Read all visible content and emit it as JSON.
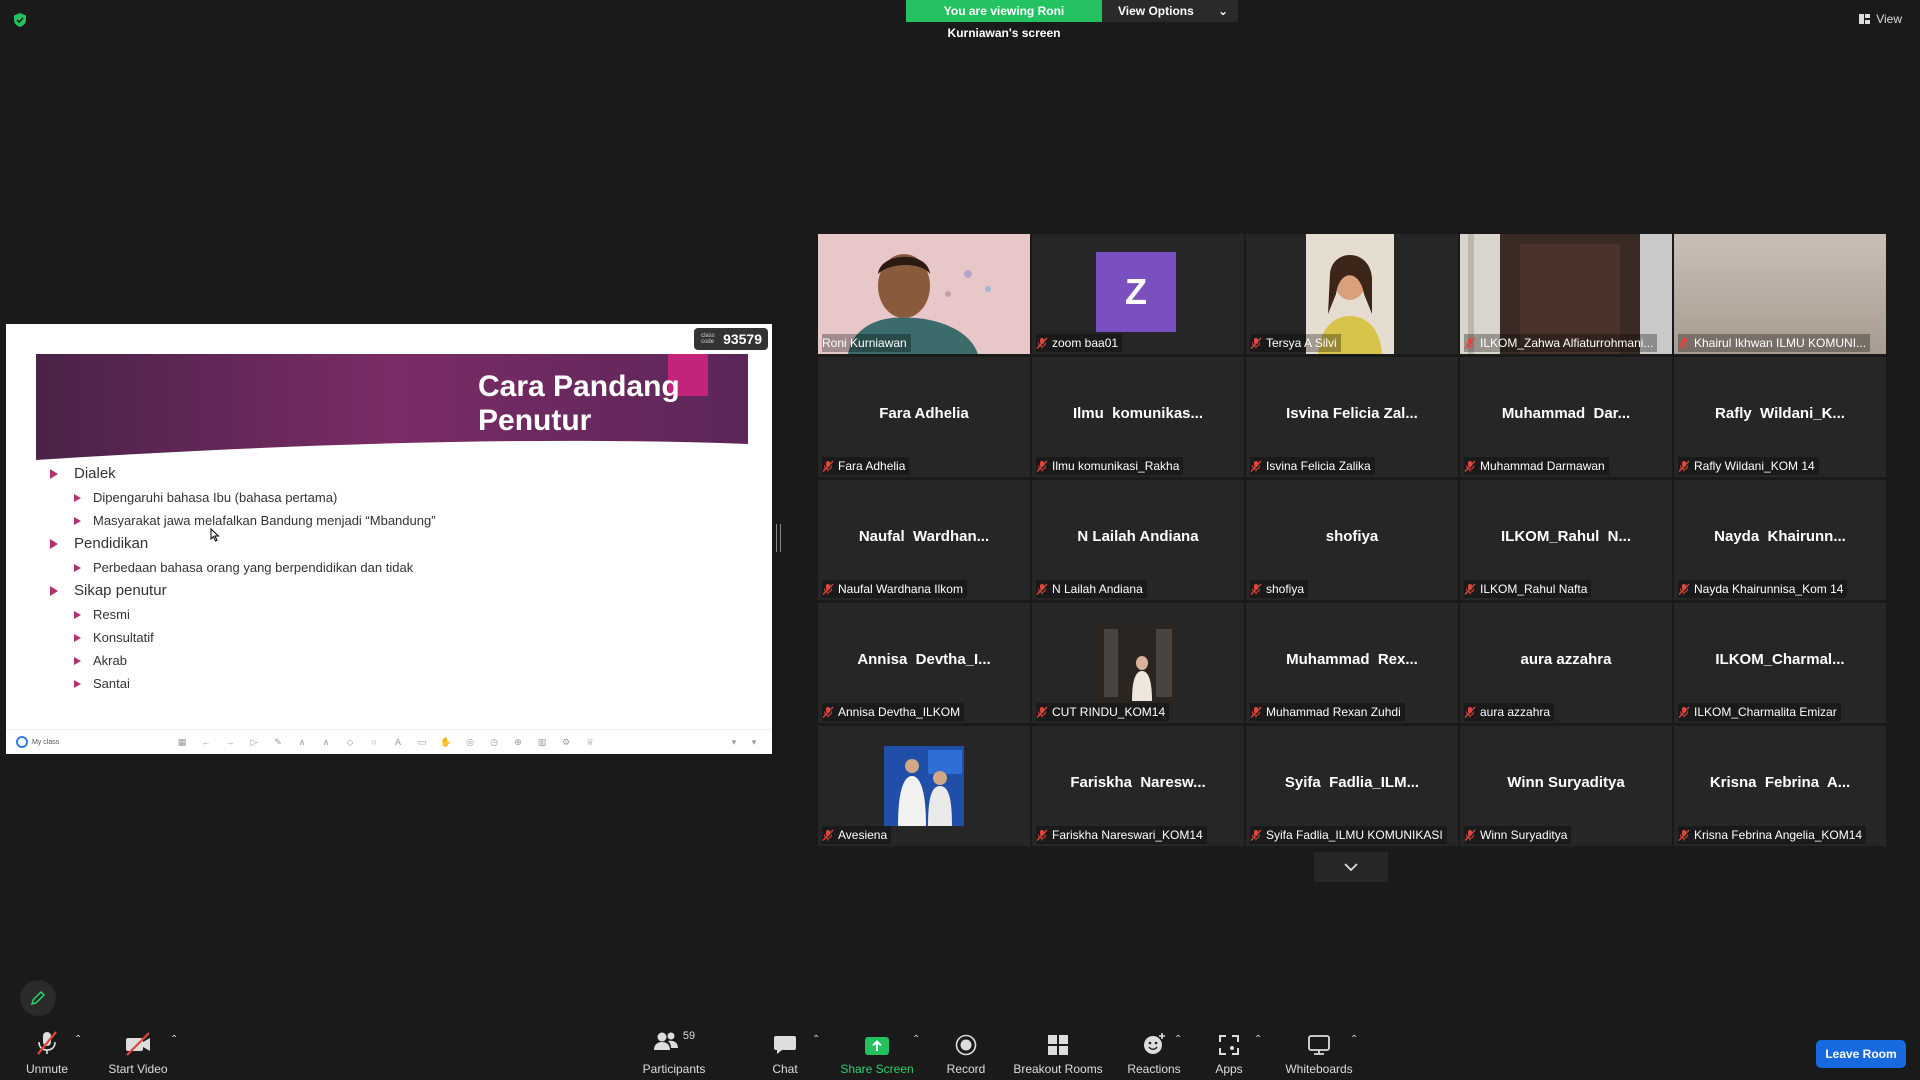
{
  "banner": {
    "viewing_text": "You are viewing Roni Kurniawan's screen",
    "view_options_label": "View Options"
  },
  "top_right": {
    "view_label": "View"
  },
  "shared_slide": {
    "title_line1": "Cara Pandang",
    "title_line2": "Penutur",
    "class_code_small": "class code",
    "class_code": "93579",
    "bullets": [
      {
        "level": 1,
        "text": "Dialek"
      },
      {
        "level": 2,
        "text": "Dipengaruhi bahasa Ibu (bahasa pertama)"
      },
      {
        "level": 2,
        "text": "Masyarakat jawa melafalkan Bandung menjadi “Mbandung”"
      },
      {
        "level": 1,
        "text": "Pendidikan"
      },
      {
        "level": 2,
        "text": "Perbedaan bahasa orang yang berpendidikan dan tidak"
      },
      {
        "level": 1,
        "text": "Sikap penutur"
      },
      {
        "level": 2,
        "text": "Resmi"
      },
      {
        "level": 2,
        "text": "Konsultatif"
      },
      {
        "level": 2,
        "text": "Akrab"
      },
      {
        "level": 2,
        "text": "Santai"
      }
    ],
    "toolbar_app_name": "My class"
  },
  "participants_tiles": [
    {
      "label": "Roni Kurniawan",
      "center": "",
      "type": "video-face",
      "active": true,
      "muted": false
    },
    {
      "label": "zoom baa01",
      "center": "",
      "type": "avatar",
      "avatar_letter": "Z",
      "muted": true
    },
    {
      "label": "Tersya A Silvi",
      "center": "",
      "type": "video-person",
      "muted": true
    },
    {
      "label": "ILKOM_Zahwa Alfiaturrohmani...",
      "center": "",
      "type": "video-room",
      "muted": true
    },
    {
      "label": "Khairul Ikhwan ILMU KOMUNI...",
      "center": "",
      "type": "video-wall",
      "muted": true
    },
    {
      "label": "Fara Adhelia",
      "center": "Fara Adhelia",
      "type": "name",
      "muted": true
    },
    {
      "label": "Ilmu komunikasi_Rakha",
      "center": "Ilmu  komunikas...",
      "type": "name",
      "muted": true
    },
    {
      "label": "Isvina Felicia Zalika",
      "center": "Isvina Felicia Zal...",
      "type": "name",
      "muted": true
    },
    {
      "label": "Muhammad Darmawan",
      "center": "Muhammad  Dar...",
      "type": "name",
      "muted": true
    },
    {
      "label": "Rafly Wildani_KOM 14",
      "center": "Rafly  Wildani_K...",
      "type": "name",
      "muted": true
    },
    {
      "label": "Naufal Wardhana Ilkom",
      "center": "Naufal  Wardhan...",
      "type": "name",
      "muted": true
    },
    {
      "label": "N Lailah Andiana",
      "center": "N Lailah Andiana",
      "type": "name",
      "muted": true
    },
    {
      "label": "shofiya",
      "center": "shofiya",
      "type": "name",
      "muted": true
    },
    {
      "label": "ILKOM_Rahul Nafta",
      "center": "ILKOM_Rahul  N...",
      "type": "name",
      "muted": true
    },
    {
      "label": "Nayda Khairunnisa_Kom 14",
      "center": "Nayda  Khairunn...",
      "type": "name",
      "muted": true
    },
    {
      "label": "Annisa Devtha_ILKOM",
      "center": "Annisa  Devtha_I...",
      "type": "name",
      "muted": true
    },
    {
      "label": "CUT RINDU_KOM14",
      "center": "",
      "type": "picture-dark",
      "muted": true
    },
    {
      "label": "Muhammad Rexan Zuhdi",
      "center": "Muhammad  Rex...",
      "type": "name",
      "muted": true
    },
    {
      "label": "aura azzahra",
      "center": "aura azzahra",
      "type": "name",
      "muted": true
    },
    {
      "label": "ILKOM_Charmalita Emizar",
      "center": "ILKOM_Charmal...",
      "type": "name",
      "muted": true
    },
    {
      "label": "Avesiena",
      "center": "",
      "type": "picture-blue",
      "muted": true
    },
    {
      "label": "Fariskha Nareswari_KOM14",
      "center": "Fariskha  Naresw...",
      "type": "name",
      "muted": true
    },
    {
      "label": "Syifa Fadlia_ILMU KOMUNIKASI",
      "center": "Syifa  Fadlia_ILM...",
      "type": "name",
      "muted": true
    },
    {
      "label": "Winn Suryaditya",
      "center": "Winn Suryaditya",
      "type": "name",
      "muted": true
    },
    {
      "label": "Krisna Febrina Angelia_KOM14",
      "center": "Krisna  Febrina  A...",
      "type": "name",
      "muted": true
    }
  ],
  "toolbar": {
    "unmute": "Unmute",
    "start_video": "Start Video",
    "participants": "Participants",
    "participants_count": "59",
    "chat": "Chat",
    "share_screen": "Share Screen",
    "record": "Record",
    "breakout_rooms": "Breakout Rooms",
    "reactions": "Reactions",
    "apps": "Apps",
    "whiteboards": "Whiteboards",
    "leave_room": "Leave Room"
  },
  "colors": {
    "banner_green": "#23c160",
    "active_speaker": "#f5e65a",
    "mute_red": "#e0463b",
    "leave_blue": "#1769e0",
    "slide_accent": "#b03370"
  }
}
